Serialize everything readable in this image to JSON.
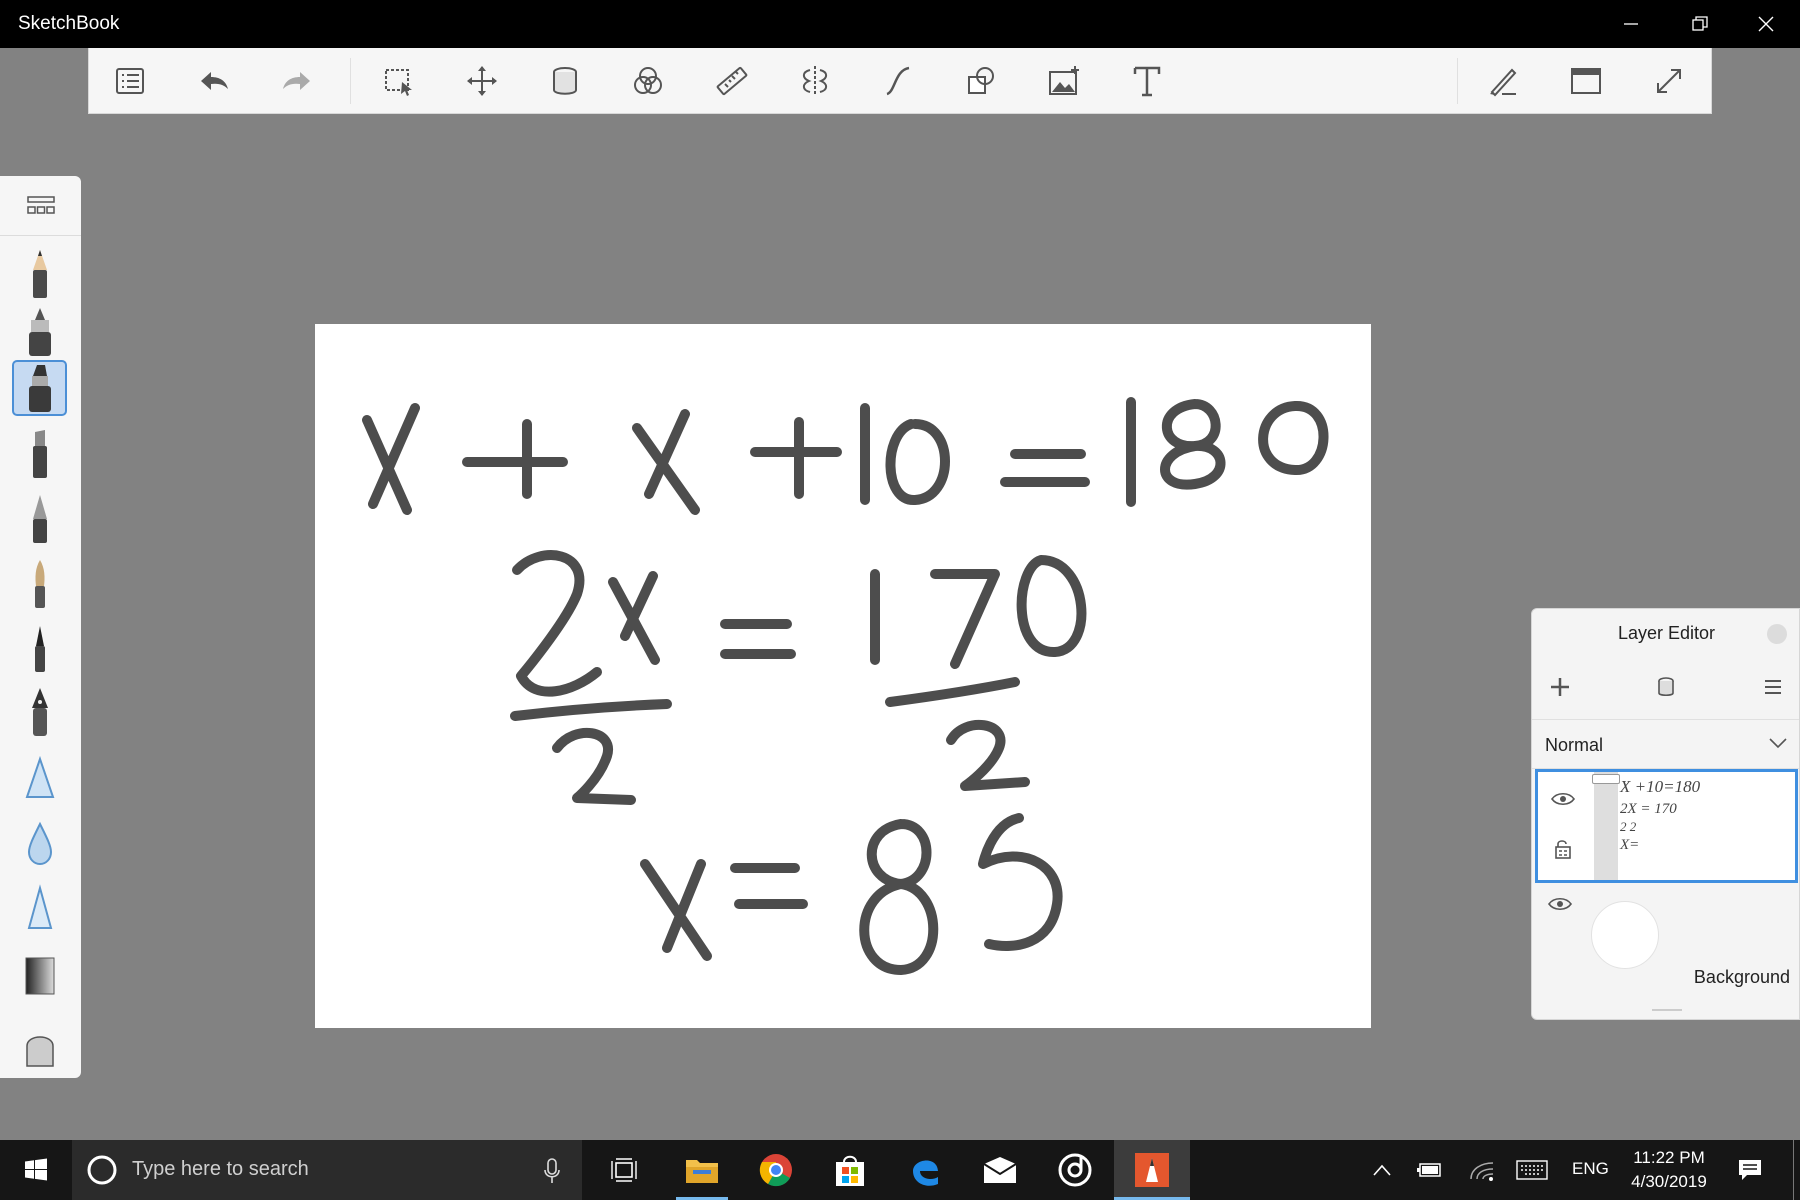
{
  "window": {
    "title": "SketchBook"
  },
  "toolbar": {
    "items": [
      {
        "name": "list-icon"
      },
      {
        "name": "undo-icon"
      },
      {
        "name": "redo-icon"
      },
      {
        "name": "select-icon"
      },
      {
        "name": "move-icon"
      },
      {
        "name": "fill-icon"
      },
      {
        "name": "color-circles-icon"
      },
      {
        "name": "ruler-icon"
      },
      {
        "name": "symmetry-icon"
      },
      {
        "name": "curve-icon"
      },
      {
        "name": "shapes-icon"
      },
      {
        "name": "add-image-icon"
      },
      {
        "name": "text-icon"
      },
      {
        "name": "pen-settings-icon"
      },
      {
        "name": "window-icon"
      },
      {
        "name": "fullscreen-icon"
      }
    ]
  },
  "palette": {
    "brushes": [
      {
        "name": "pencil-brush"
      },
      {
        "name": "airbrush-brush"
      },
      {
        "name": "marker-brush",
        "active": true
      },
      {
        "name": "chisel-brush"
      },
      {
        "name": "ballpoint-brush"
      },
      {
        "name": "paint-brush"
      },
      {
        "name": "fine-brush"
      },
      {
        "name": "ink-pen-brush"
      },
      {
        "name": "blue-triangle-brush"
      },
      {
        "name": "blue-drop-brush"
      },
      {
        "name": "blue-cone-brush"
      },
      {
        "name": "gradient-brush"
      },
      {
        "name": "eraser-brush"
      }
    ]
  },
  "canvas": {
    "lines": [
      "X + X + 10 = 180",
      "2X = 170",
      "2 2",
      "X = 85"
    ]
  },
  "layer_editor": {
    "title": "Layer Editor",
    "blend_mode": "Normal",
    "layers": [
      {
        "name": "drawing-layer",
        "thumbnail_lines": [
          "X +10=180",
          "2X = 170",
          "2 2",
          "X="
        ]
      },
      {
        "name": "background-layer",
        "label": "Background"
      }
    ]
  },
  "taskbar": {
    "search_placeholder": "Type here to search",
    "language": "ENG",
    "time": "11:22 PM",
    "date": "4/30/2019"
  },
  "colors": {
    "accent": "#3f8fe0",
    "workspace": "#828282",
    "titlebar": "#000000",
    "sketchbook_orange": "#e4572e"
  }
}
